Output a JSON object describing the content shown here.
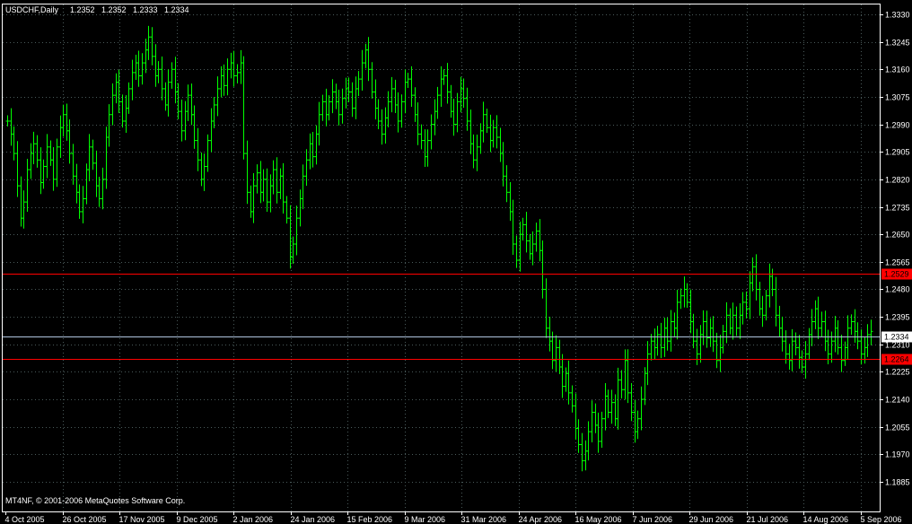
{
  "chart_data": {
    "type": "ohlc",
    "title": "USDCHF,Daily",
    "header_ohlc": [
      "1.2352",
      "1.2352",
      "1.2333",
      "1.2334"
    ],
    "watermark": "MT4NF, © 2001-2006 MetaQuotes Software Corp.",
    "ylim": [
      1.1885,
      1.333
    ],
    "y_ticks": [
      "1.3330",
      "1.3245",
      "1.3160",
      "1.3075",
      "1.2990",
      "1.2905",
      "1.2820",
      "1.2735",
      "1.2650",
      "1.2565",
      "1.2480",
      "1.2395",
      "1.2310",
      "1.2225",
      "1.2140",
      "1.2055",
      "1.1970",
      "1.1885"
    ],
    "x_labels": [
      "4 Oct 2005",
      "26 Oct 2005",
      "17 Nov 2005",
      "9 Dec 2005",
      "2 Jan 2006",
      "24 Jan 2006",
      "15 Feb 2006",
      "9 Mar 2006",
      "31 Mar 2006",
      "24 Apr 2006",
      "16 May 2006",
      "7 Jun 2006",
      "29 Jun 2006",
      "21 Jul 2006",
      "14 Aug 2006",
      "5 Sep 2006"
    ],
    "grid": true,
    "levels": [
      {
        "value": 1.2529,
        "label": "1.2529",
        "color": "#ff0000"
      },
      {
        "value": 1.2334,
        "label": "1.2334",
        "color": "#b0c4de"
      },
      {
        "value": 1.2264,
        "label": "1.2264",
        "color": "#ff0000"
      }
    ],
    "colors": {
      "bars": "#00ff00",
      "grid": "#4a5a5a",
      "axis": "#ffffff",
      "support": "#ff0000",
      "bid": "#b0c4de"
    },
    "closes": [
      1.3,
      1.296,
      1.29,
      1.28,
      1.27,
      1.275,
      1.285,
      1.29,
      1.293,
      1.288,
      1.281,
      1.286,
      1.292,
      1.288,
      1.282,
      1.292,
      1.298,
      1.302,
      1.297,
      1.29,
      1.283,
      1.278,
      1.272,
      1.276,
      1.285,
      1.292,
      1.287,
      1.28,
      1.276,
      1.282,
      1.295,
      1.302,
      1.308,
      1.312,
      1.306,
      1.3,
      1.304,
      1.31,
      1.315,
      1.318,
      1.314,
      1.318,
      1.322,
      1.326,
      1.32,
      1.314,
      1.316,
      1.31,
      1.305,
      1.312,
      1.316,
      1.309,
      1.303,
      1.297,
      1.303,
      1.308,
      1.302,
      1.294,
      1.288,
      1.282,
      1.286,
      1.294,
      1.3,
      1.305,
      1.31,
      1.314,
      1.311,
      1.316,
      1.318,
      1.314,
      1.315,
      1.318,
      1.29,
      1.278,
      1.272,
      1.28,
      1.284,
      1.278,
      1.282,
      1.275,
      1.28,
      1.285,
      1.278,
      1.283,
      1.275,
      1.27,
      1.258,
      1.262,
      1.27,
      1.276,
      1.283,
      1.288,
      1.293,
      1.289,
      1.296,
      1.302,
      1.306,
      1.302,
      1.306,
      1.309,
      1.306,
      1.302,
      1.307,
      1.31,
      1.309,
      1.304,
      1.31,
      1.313,
      1.318,
      1.322,
      1.316,
      1.309,
      1.304,
      1.3,
      1.296,
      1.301,
      1.306,
      1.31,
      1.305,
      1.3,
      1.306,
      1.312,
      1.313,
      1.308,
      1.302,
      1.296,
      1.294,
      1.289,
      1.294,
      1.299,
      1.303,
      1.308,
      1.313,
      1.314,
      1.309,
      1.303,
      1.299,
      1.306,
      1.31,
      1.307,
      1.3,
      1.293,
      1.288,
      1.292,
      1.297,
      1.302,
      1.298,
      1.294,
      1.298,
      1.295,
      1.29,
      1.283,
      1.278,
      1.272,
      1.262,
      1.257,
      1.265,
      1.268,
      1.263,
      1.259,
      1.262,
      1.266,
      1.26,
      1.248,
      1.236,
      1.232,
      1.226,
      1.23,
      1.224,
      1.218,
      1.222,
      1.216,
      1.212,
      1.205,
      1.2,
      1.195,
      1.198,
      1.204,
      1.21,
      1.206,
      1.201,
      1.208,
      1.215,
      1.21,
      1.213,
      1.208,
      1.22,
      1.217,
      1.226,
      1.216,
      1.21,
      1.204,
      1.208,
      1.214,
      1.222,
      1.228,
      1.232,
      1.23,
      1.234,
      1.23,
      1.236,
      1.232,
      1.238,
      1.236,
      1.244,
      1.246,
      1.248,
      1.244,
      1.238,
      1.232,
      1.228,
      1.234,
      1.238,
      1.233,
      1.236,
      1.232,
      1.226,
      1.23,
      1.235,
      1.24,
      1.236,
      1.24,
      1.236,
      1.24,
      1.244,
      1.242,
      1.25,
      1.255,
      1.248,
      1.242,
      1.24,
      1.246,
      1.252,
      1.248,
      1.24,
      1.236,
      1.232,
      1.228,
      1.226,
      1.232,
      1.23,
      1.227,
      1.224,
      1.228,
      1.234,
      1.238,
      1.242,
      1.236,
      1.238,
      1.232,
      1.228,
      1.232,
      1.236,
      1.23,
      1.226,
      1.23,
      1.236,
      1.238,
      1.235,
      1.232,
      1.228,
      1.23,
      1.234,
      1.235
    ]
  }
}
